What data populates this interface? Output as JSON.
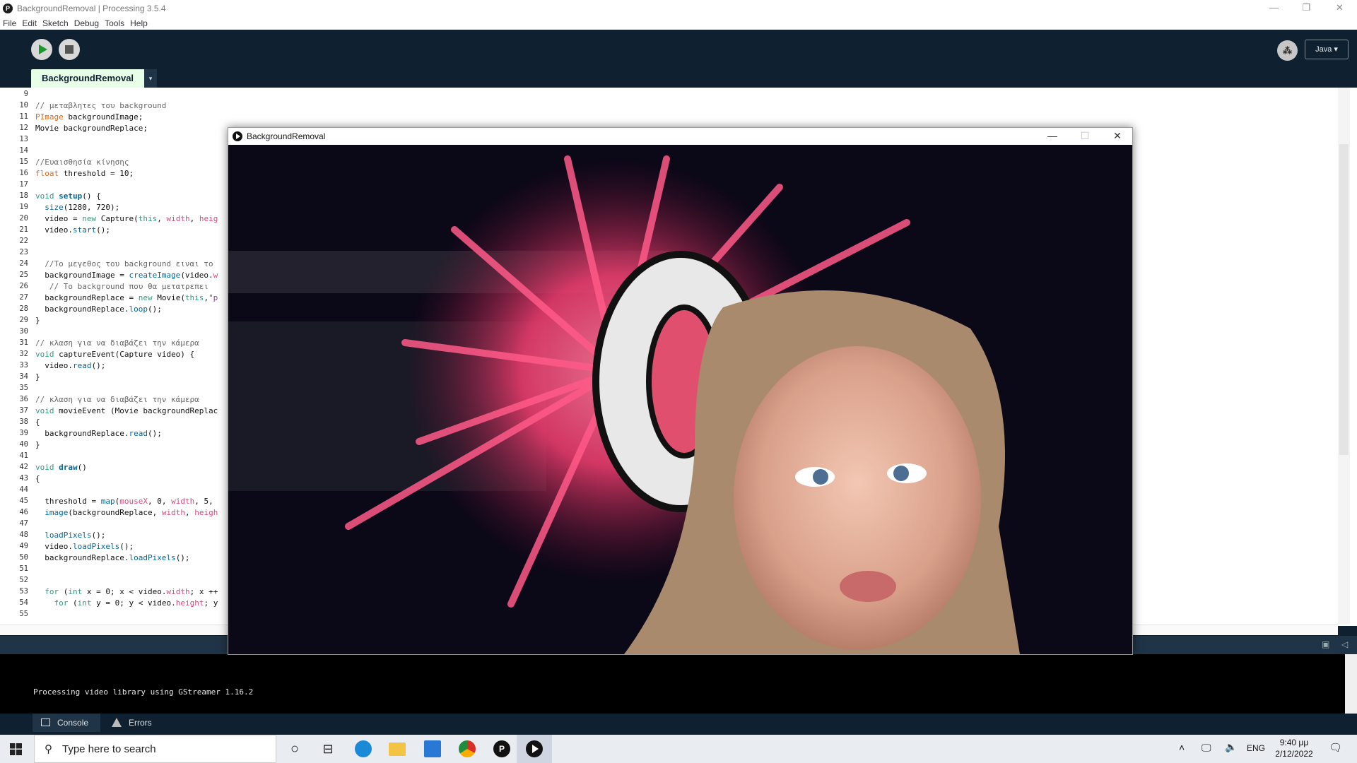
{
  "window": {
    "title": "BackgroundRemoval | Processing 3.5.4"
  },
  "menu": [
    "File",
    "Edit",
    "Sketch",
    "Debug",
    "Tools",
    "Help"
  ],
  "toolbar": {
    "mode": "Java ▾"
  },
  "tab": {
    "name": "BackgroundRemoval",
    "menu_glyph": "▾"
  },
  "code": {
    "line_numbers": [
      "9",
      "10",
      "11",
      "12",
      "13",
      "14",
      "15",
      "16",
      "17",
      "18",
      "19",
      "20",
      "21",
      "22",
      "23",
      "24",
      "25",
      "26",
      "27",
      "28",
      "29",
      "30",
      "31",
      "32",
      "33",
      "34",
      "35",
      "36",
      "37",
      "38",
      "39",
      "40",
      "41",
      "42",
      "43",
      "44",
      "45",
      "46",
      "47",
      "48",
      "49",
      "50",
      "51",
      "52",
      "53",
      "54",
      "55"
    ]
  },
  "sketch_window": {
    "title": "BackgroundRemoval"
  },
  "console": {
    "output": "Processing video library using GStreamer 1.16.2",
    "tabs": [
      "Console",
      "Errors"
    ]
  },
  "taskbar": {
    "search_placeholder": "Type here to search",
    "language": "ENG",
    "time": "9:40 μμ",
    "date": "2/12/2022"
  },
  "colors": {
    "ide_dark": "#0f2130",
    "tab_active": "#e6ffe6",
    "run_green": "#1b9a2c"
  }
}
